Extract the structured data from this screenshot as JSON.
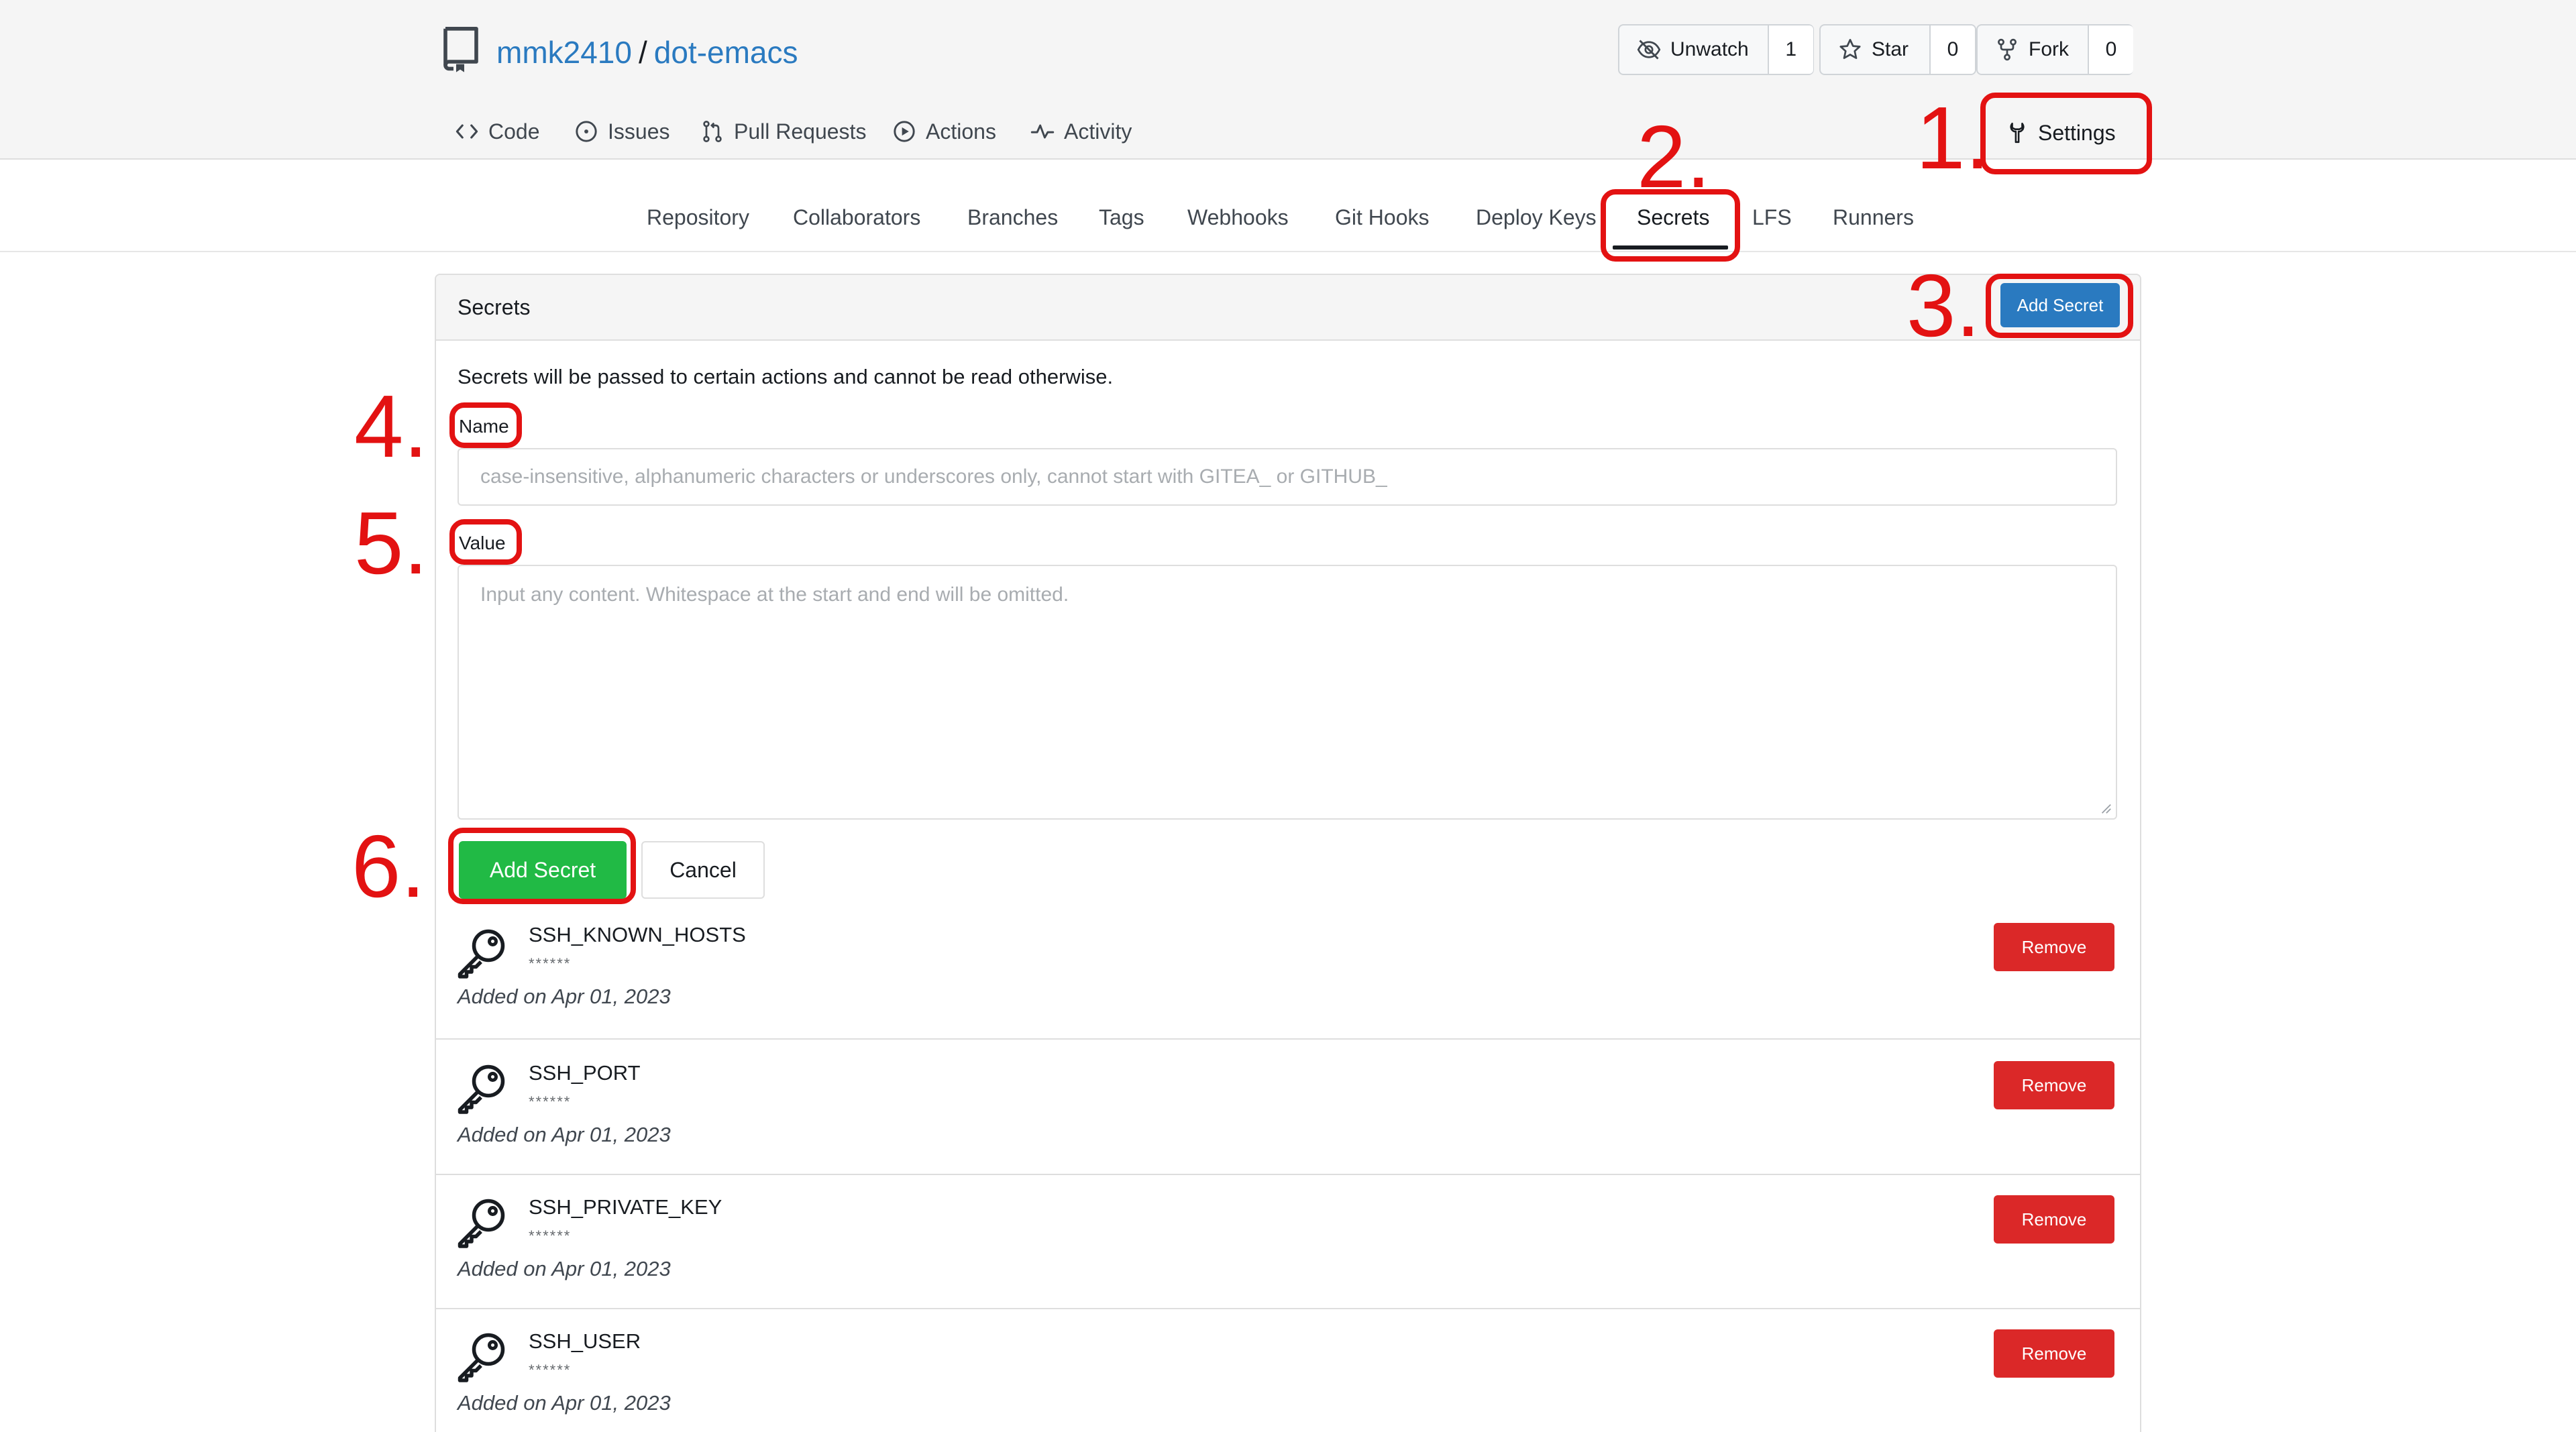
{
  "repo": {
    "owner": "mmk2410",
    "separator": "/",
    "name": "dot-emacs"
  },
  "actions": [
    {
      "label": "Unwatch",
      "count": "1",
      "icon": "eye-slash-icon"
    },
    {
      "label": "Star",
      "count": "0",
      "icon": "star-icon"
    },
    {
      "label": "Fork",
      "count": "0",
      "icon": "fork-icon"
    }
  ],
  "repo_tabs": [
    {
      "label": "Code",
      "icon": "code-icon"
    },
    {
      "label": "Issues",
      "icon": "issue-icon"
    },
    {
      "label": "Pull Requests",
      "icon": "pull-request-icon"
    },
    {
      "label": "Actions",
      "icon": "play-icon"
    },
    {
      "label": "Activity",
      "icon": "pulse-icon"
    }
  ],
  "settings_tab": {
    "label": "Settings",
    "icon": "wrench-icon"
  },
  "settings_nav": [
    "Repository",
    "Collaborators",
    "Branches",
    "Tags",
    "Webhooks",
    "Git Hooks",
    "Deploy Keys",
    "Secrets",
    "LFS",
    "Runners"
  ],
  "settings_nav_active": "Secrets",
  "panel": {
    "title": "Secrets",
    "add_button": "Add Secret",
    "description": "Secrets will be passed to certain actions and cannot be read otherwise.",
    "name_label": "Name",
    "name_placeholder": "case-insensitive, alphanumeric characters or underscores only, cannot start with GITEA_ or GITHUB_",
    "value_label": "Value",
    "value_placeholder": "Input any content. Whitespace at the start and end will be omitted.",
    "submit_button": "Add Secret",
    "cancel_button": "Cancel"
  },
  "secrets": [
    {
      "name": "SSH_KNOWN_HOSTS",
      "mask": "******",
      "added": "Added on Apr 01, 2023",
      "remove": "Remove"
    },
    {
      "name": "SSH_PORT",
      "mask": "******",
      "added": "Added on Apr 01, 2023",
      "remove": "Remove"
    },
    {
      "name": "SSH_PRIVATE_KEY",
      "mask": "******",
      "added": "Added on Apr 01, 2023",
      "remove": "Remove"
    },
    {
      "name": "SSH_USER",
      "mask": "******",
      "added": "Added on Apr 01, 2023",
      "remove": "Remove"
    }
  ],
  "annotations": [
    "1.",
    "2.",
    "3.",
    "4.",
    "5.",
    "6."
  ],
  "colors": {
    "link": "#2a7ac0",
    "primary": "#2a7ac0",
    "success": "#21ba45",
    "danger": "#db2828",
    "annotation": "#e31212"
  }
}
